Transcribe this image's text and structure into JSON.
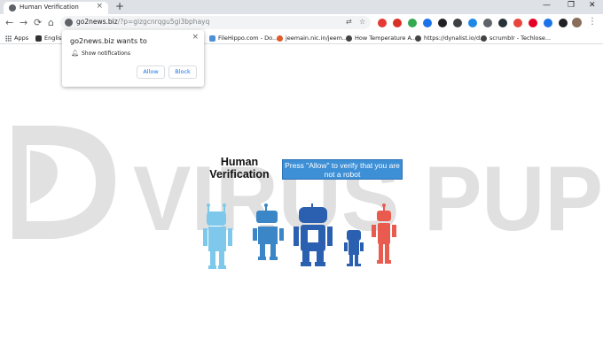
{
  "tab": {
    "title": "Human Verification",
    "close": "×",
    "new_tab": "+"
  },
  "window_controls": {
    "minimize": "—",
    "maximize": "❐",
    "close": "✕"
  },
  "nav": {
    "back": "←",
    "forward": "→",
    "reload": "⟳",
    "home": "⌂"
  },
  "omnibox": {
    "host": "go2news.biz",
    "path": "/?p=gizgcnrqgu5gi3bphayq"
  },
  "bookmarks": [
    {
      "label": "Apps",
      "color": "#5f6368"
    },
    {
      "label": "English",
      "color": "#333333"
    },
    {
      "label": "FileHippo.com - Do...",
      "color": "#4f8fd8"
    },
    {
      "label": "jeemain.nic.in/jeem...",
      "color": "#e05a2b"
    },
    {
      "label": "How Temperature A...",
      "color": "#444444"
    },
    {
      "label": "https://dynalist.io/d...",
      "color": "#444444"
    },
    {
      "label": "scrumblr - Techlose...",
      "color": "#444444"
    }
  ],
  "popup": {
    "title": "go2news.biz wants to",
    "permission": "Show notifications",
    "allow_label": "Allow",
    "block_label": "Block",
    "close": "×"
  },
  "page": {
    "watermark": "VIRUS PUP",
    "title_line1": "Human",
    "title_line2": "Verification",
    "banner_line1": "Press \"Allow\" to verify that you are",
    "banner_line2": "not a robot"
  },
  "colors": {
    "banner_bg": "#3d8fd6",
    "robot_light_blue": "#7ec8ec",
    "robot_blue": "#3a86c6",
    "robot_dark_blue": "#2b5faf",
    "robot_red": "#ea5b4f"
  }
}
